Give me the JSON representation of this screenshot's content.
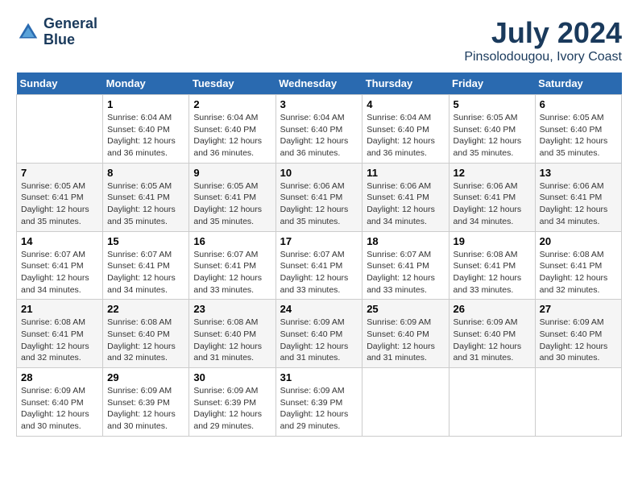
{
  "header": {
    "logo_line1": "General",
    "logo_line2": "Blue",
    "month": "July 2024",
    "location": "Pinsolodougou, Ivory Coast"
  },
  "weekdays": [
    "Sunday",
    "Monday",
    "Tuesday",
    "Wednesday",
    "Thursday",
    "Friday",
    "Saturday"
  ],
  "weeks": [
    [
      {
        "day": "",
        "info": ""
      },
      {
        "day": "1",
        "info": "Sunrise: 6:04 AM\nSunset: 6:40 PM\nDaylight: 12 hours\nand 36 minutes."
      },
      {
        "day": "2",
        "info": "Sunrise: 6:04 AM\nSunset: 6:40 PM\nDaylight: 12 hours\nand 36 minutes."
      },
      {
        "day": "3",
        "info": "Sunrise: 6:04 AM\nSunset: 6:40 PM\nDaylight: 12 hours\nand 36 minutes."
      },
      {
        "day": "4",
        "info": "Sunrise: 6:04 AM\nSunset: 6:40 PM\nDaylight: 12 hours\nand 36 minutes."
      },
      {
        "day": "5",
        "info": "Sunrise: 6:05 AM\nSunset: 6:40 PM\nDaylight: 12 hours\nand 35 minutes."
      },
      {
        "day": "6",
        "info": "Sunrise: 6:05 AM\nSunset: 6:40 PM\nDaylight: 12 hours\nand 35 minutes."
      }
    ],
    [
      {
        "day": "7",
        "info": "Sunrise: 6:05 AM\nSunset: 6:41 PM\nDaylight: 12 hours\nand 35 minutes."
      },
      {
        "day": "8",
        "info": "Sunrise: 6:05 AM\nSunset: 6:41 PM\nDaylight: 12 hours\nand 35 minutes."
      },
      {
        "day": "9",
        "info": "Sunrise: 6:05 AM\nSunset: 6:41 PM\nDaylight: 12 hours\nand 35 minutes."
      },
      {
        "day": "10",
        "info": "Sunrise: 6:06 AM\nSunset: 6:41 PM\nDaylight: 12 hours\nand 35 minutes."
      },
      {
        "day": "11",
        "info": "Sunrise: 6:06 AM\nSunset: 6:41 PM\nDaylight: 12 hours\nand 34 minutes."
      },
      {
        "day": "12",
        "info": "Sunrise: 6:06 AM\nSunset: 6:41 PM\nDaylight: 12 hours\nand 34 minutes."
      },
      {
        "day": "13",
        "info": "Sunrise: 6:06 AM\nSunset: 6:41 PM\nDaylight: 12 hours\nand 34 minutes."
      }
    ],
    [
      {
        "day": "14",
        "info": "Sunrise: 6:07 AM\nSunset: 6:41 PM\nDaylight: 12 hours\nand 34 minutes."
      },
      {
        "day": "15",
        "info": "Sunrise: 6:07 AM\nSunset: 6:41 PM\nDaylight: 12 hours\nand 34 minutes."
      },
      {
        "day": "16",
        "info": "Sunrise: 6:07 AM\nSunset: 6:41 PM\nDaylight: 12 hours\nand 33 minutes."
      },
      {
        "day": "17",
        "info": "Sunrise: 6:07 AM\nSunset: 6:41 PM\nDaylight: 12 hours\nand 33 minutes."
      },
      {
        "day": "18",
        "info": "Sunrise: 6:07 AM\nSunset: 6:41 PM\nDaylight: 12 hours\nand 33 minutes."
      },
      {
        "day": "19",
        "info": "Sunrise: 6:08 AM\nSunset: 6:41 PM\nDaylight: 12 hours\nand 33 minutes."
      },
      {
        "day": "20",
        "info": "Sunrise: 6:08 AM\nSunset: 6:41 PM\nDaylight: 12 hours\nand 32 minutes."
      }
    ],
    [
      {
        "day": "21",
        "info": "Sunrise: 6:08 AM\nSunset: 6:41 PM\nDaylight: 12 hours\nand 32 minutes."
      },
      {
        "day": "22",
        "info": "Sunrise: 6:08 AM\nSunset: 6:40 PM\nDaylight: 12 hours\nand 32 minutes."
      },
      {
        "day": "23",
        "info": "Sunrise: 6:08 AM\nSunset: 6:40 PM\nDaylight: 12 hours\nand 31 minutes."
      },
      {
        "day": "24",
        "info": "Sunrise: 6:09 AM\nSunset: 6:40 PM\nDaylight: 12 hours\nand 31 minutes."
      },
      {
        "day": "25",
        "info": "Sunrise: 6:09 AM\nSunset: 6:40 PM\nDaylight: 12 hours\nand 31 minutes."
      },
      {
        "day": "26",
        "info": "Sunrise: 6:09 AM\nSunset: 6:40 PM\nDaylight: 12 hours\nand 31 minutes."
      },
      {
        "day": "27",
        "info": "Sunrise: 6:09 AM\nSunset: 6:40 PM\nDaylight: 12 hours\nand 30 minutes."
      }
    ],
    [
      {
        "day": "28",
        "info": "Sunrise: 6:09 AM\nSunset: 6:40 PM\nDaylight: 12 hours\nand 30 minutes."
      },
      {
        "day": "29",
        "info": "Sunrise: 6:09 AM\nSunset: 6:39 PM\nDaylight: 12 hours\nand 30 minutes."
      },
      {
        "day": "30",
        "info": "Sunrise: 6:09 AM\nSunset: 6:39 PM\nDaylight: 12 hours\nand 29 minutes."
      },
      {
        "day": "31",
        "info": "Sunrise: 6:09 AM\nSunset: 6:39 PM\nDaylight: 12 hours\nand 29 minutes."
      },
      {
        "day": "",
        "info": ""
      },
      {
        "day": "",
        "info": ""
      },
      {
        "day": "",
        "info": ""
      }
    ]
  ]
}
